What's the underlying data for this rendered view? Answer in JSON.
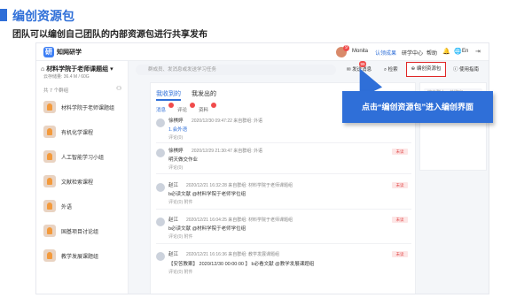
{
  "slide": {
    "title": "编创资源包",
    "subtitle": "团队可以编创自己团队的内部资源包进行共享发布"
  },
  "app": {
    "logo_text": "知网研学",
    "logo_glyph": "研",
    "user_name": "Monita",
    "user_badge": "9",
    "top_nav": [
      "认领成果",
      "研学中心",
      "帮助"
    ],
    "lang": "En"
  },
  "sidebar": {
    "team_name": "材料学院于老师课题组",
    "team_meta": "云存储量: 36.4 M / 60G",
    "group_count": "共 7 个群组",
    "groups": [
      "材料学院于老师课题组",
      "有机化学课程",
      "人工智能学习小组",
      "文献检索课程",
      "外语",
      "国基项目讨论组",
      "教学发展课题组"
    ]
  },
  "toolbar": {
    "search_placeholder": "群成员、发消息或发送学习任务",
    "message_label": "发送消息",
    "message_badge": "99",
    "search_label": "检索",
    "create_package_label": "编创资源包",
    "guide_label": "使用指南"
  },
  "feed": {
    "tabs": [
      "我收到的",
      "我发出的"
    ],
    "subtabs": [
      "消息",
      "评论",
      "资料"
    ],
    "right_search_placeholder": "搜索群人、关键字",
    "posts": [
      {
        "name": "徐棋婷",
        "meta": "2020/12/30 09:47:22     来自群组: 外语",
        "body": "1.会外语",
        "body_blue": true,
        "tool": "评论(0)",
        "tag": ""
      },
      {
        "name": "徐棋婷",
        "meta": "2020/12/29 21:30:47     来自群组: 外语",
        "body": "明天做交作业",
        "body_blue": false,
        "tool": "评论(0)",
        "tag": "未读"
      },
      {
        "name": "赵江",
        "meta": "2020/12/21 16:32:28     来自群组: 材料学院于老师课题组",
        "body": "b必读文献 @材料学院于老师学位组",
        "body_blue": false,
        "tool": "评论(0)      附件",
        "tag": "未读"
      },
      {
        "name": "赵江",
        "meta": "2020/12/21 16:04:25     来自群组: 材料学院于老师课题组",
        "body": "b必读文献 @材料学院于老师学位组",
        "body_blue": false,
        "tool": "评论(0)      附件",
        "tag": "未读"
      },
      {
        "name": "赵江",
        "meta": "2020/12/21 16:16:36     来自群组: 教学发展课题组",
        "body": "【安答教案】 2020/12/30 00:00:00 】 b必看文献 @教学发展课题组",
        "body_blue": false,
        "tool": "评论(0)      附件",
        "tag": "未读"
      }
    ]
  },
  "callout": {
    "text": "点击“编创资源包”进入编创界面"
  },
  "colors": {
    "accent": "#2f6fd8",
    "highlight": "#e02727"
  }
}
